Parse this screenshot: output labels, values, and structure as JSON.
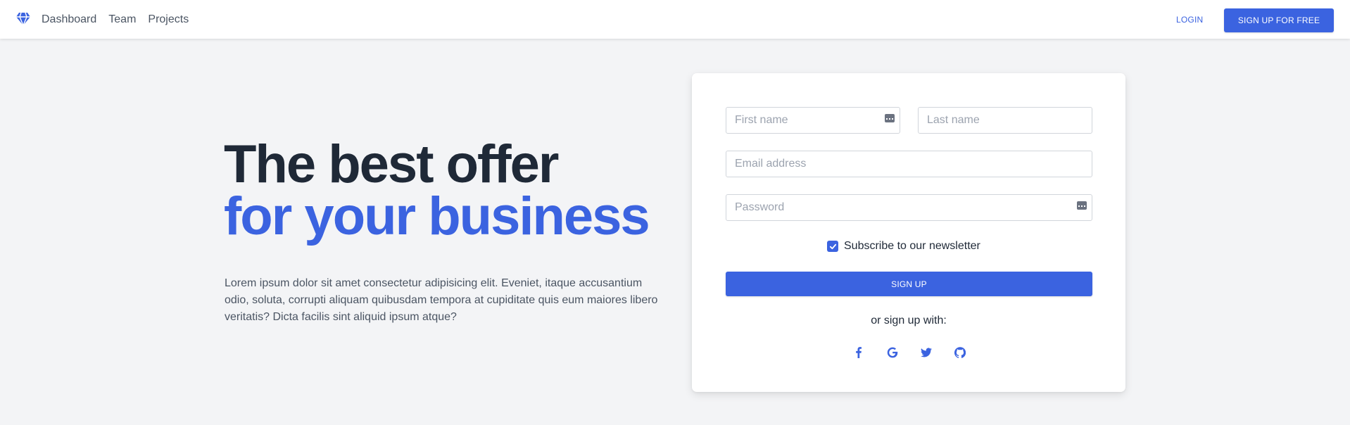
{
  "nav": {
    "links": [
      "Dashboard",
      "Team",
      "Projects"
    ],
    "login_label": "LOGIN",
    "signup_free_label": "SIGN UP FOR FREE"
  },
  "hero": {
    "title_line1": "The best offer",
    "title_line2": "for your business",
    "text": "Lorem ipsum dolor sit amet consectetur adipisicing elit. Eveniet, itaque accusantium odio, soluta, corrupti aliquam quibusdam tempora at cupiditate quis eum maiores libero veritatis? Dicta facilis sint aliquid ipsum atque?"
  },
  "form": {
    "first_name_placeholder": "First name",
    "last_name_placeholder": "Last name",
    "email_placeholder": "Email address",
    "password_placeholder": "Password",
    "newsletter_label": "Subscribe to our newsletter",
    "newsletter_checked": true,
    "submit_label": "SIGN UP",
    "or_text": "or sign up with:",
    "socials": [
      "facebook-icon",
      "google-icon",
      "twitter-icon",
      "github-icon"
    ]
  },
  "colors": {
    "accent": "#3b63e0",
    "background": "#f3f4f6",
    "heading": "#1f2937",
    "body_text": "#4b5563"
  }
}
